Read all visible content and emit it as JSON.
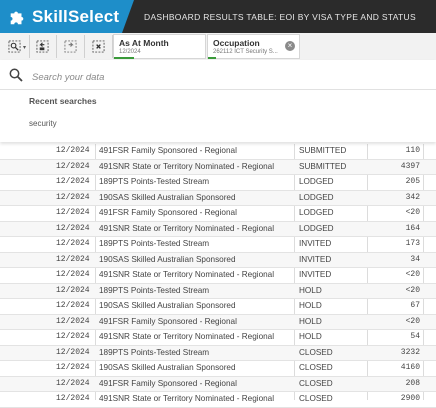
{
  "header": {
    "logo_text": "SkillSelect",
    "title": "DASHBOARD RESULTS TABLE: EOI BY VISA TYPE AND STATUS",
    "logo_color": "#1e8ec9",
    "bar_color": "#2b2b2b"
  },
  "toolbar": {
    "buttons": [
      {
        "icon": "smart-search-icon"
      },
      {
        "icon": "step-back-icon"
      },
      {
        "icon": "step-forward-icon"
      },
      {
        "icon": "clear-selections-icon"
      }
    ],
    "selections": [
      {
        "title": "As At Month",
        "value": "12/2024"
      },
      {
        "title": "Occupation",
        "value": "262112 ICT Security S..."
      }
    ],
    "selection_accent": "#3a9a3a"
  },
  "search": {
    "placeholder": "Search your data",
    "recent_title": "Recent searches",
    "recent_items": [
      "security"
    ]
  },
  "table": {
    "rows": [
      {
        "month": "12/2024",
        "visa": "491FSR Family Sponsored - Regional",
        "status": "SUBMITTED",
        "count": "110"
      },
      {
        "month": "12/2024",
        "visa": "491SNR State or Territory Nominated - Regional",
        "status": "SUBMITTED",
        "count": "4397"
      },
      {
        "month": "12/2024",
        "visa": "189PTS Points-Tested Stream",
        "status": "LODGED",
        "count": "205"
      },
      {
        "month": "12/2024",
        "visa": "190SAS Skilled Australian Sponsored",
        "status": "LODGED",
        "count": "342"
      },
      {
        "month": "12/2024",
        "visa": "491FSR Family Sponsored - Regional",
        "status": "LODGED",
        "count": "<20"
      },
      {
        "month": "12/2024",
        "visa": "491SNR State or Territory Nominated - Regional",
        "status": "LODGED",
        "count": "164"
      },
      {
        "month": "12/2024",
        "visa": "189PTS Points-Tested Stream",
        "status": "INVITED",
        "count": "173"
      },
      {
        "month": "12/2024",
        "visa": "190SAS Skilled Australian Sponsored",
        "status": "INVITED",
        "count": "34"
      },
      {
        "month": "12/2024",
        "visa": "491SNR State or Territory Nominated - Regional",
        "status": "INVITED",
        "count": "<20"
      },
      {
        "month": "12/2024",
        "visa": "189PTS Points-Tested Stream",
        "status": "HOLD",
        "count": "<20"
      },
      {
        "month": "12/2024",
        "visa": "190SAS Skilled Australian Sponsored",
        "status": "HOLD",
        "count": "67"
      },
      {
        "month": "12/2024",
        "visa": "491FSR Family Sponsored - Regional",
        "status": "HOLD",
        "count": "<20"
      },
      {
        "month": "12/2024",
        "visa": "491SNR State or Territory Nominated - Regional",
        "status": "HOLD",
        "count": "54"
      },
      {
        "month": "12/2024",
        "visa": "189PTS Points-Tested Stream",
        "status": "CLOSED",
        "count": "3232"
      },
      {
        "month": "12/2024",
        "visa": "190SAS Skilled Australian Sponsored",
        "status": "CLOSED",
        "count": "4160"
      },
      {
        "month": "12/2024",
        "visa": "491FSR Family Sponsored - Regional",
        "status": "CLOSED",
        "count": "208"
      },
      {
        "month": "12/2024",
        "visa": "491SNR State or Territory Nominated - Regional",
        "status": "CLOSED",
        "count": "2900"
      }
    ]
  }
}
